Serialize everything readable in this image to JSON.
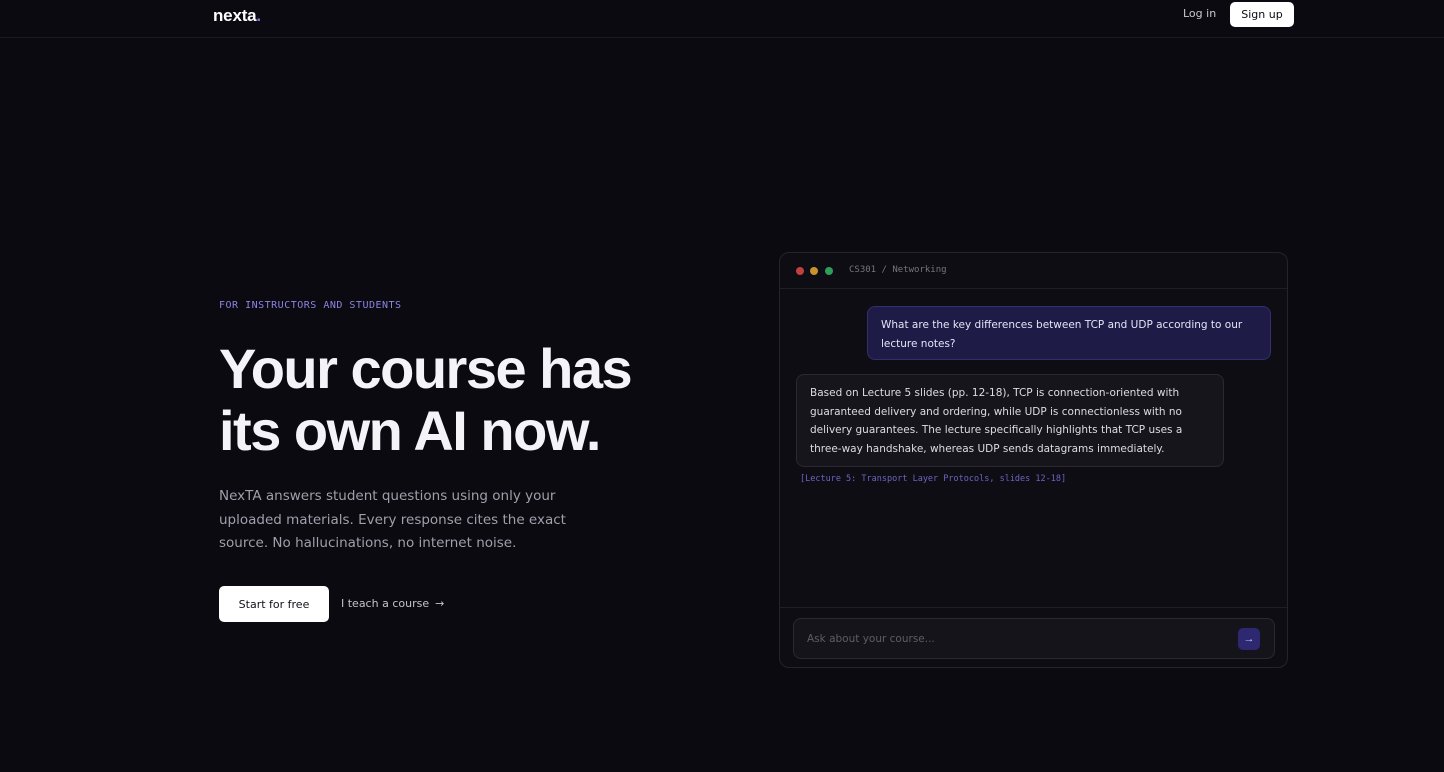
{
  "header": {
    "logo_text": "nexta",
    "logo_dot": ".",
    "login_label": "Log in",
    "signup_label": "Sign up"
  },
  "hero": {
    "eyebrow": "FOR INSTRUCTORS AND STUDENTS",
    "headline_line1": "Your course has",
    "headline_line2": "its own AI now.",
    "subtext": "NexTA answers student questions using only your uploaded materials. Every response cites the exact source. No hallucinations, no internet noise.",
    "primary_cta": "Start for free",
    "secondary_cta": "I teach a course",
    "secondary_cta_icon": "arrow-right-icon"
  },
  "chat": {
    "path": "CS301 / Networking",
    "user_message": "What are the key differences between TCP and UDP according to our lecture notes?",
    "ai_message": "Based on Lecture 5 slides (pp. 12-18), TCP is connection-oriented with guaranteed delivery and ordering, while UDP is connectionless with no delivery guarantees. The lecture specifically highlights that TCP uses a three-way handshake, whereas UDP sends datagrams immediately.",
    "citation": "[Lecture 5: Transport Layer Protocols, slides 12-18]",
    "input_value": "",
    "input_placeholder": "Ask about your course...",
    "send_icon": "arrow-right-icon"
  },
  "colors": {
    "background": "#0b0a10",
    "accent": "#7c74e8",
    "user_bubble": "#1e1b47",
    "traffic_red": "#c0413f",
    "traffic_yellow": "#c7932c",
    "traffic_green": "#2f9e5b"
  }
}
